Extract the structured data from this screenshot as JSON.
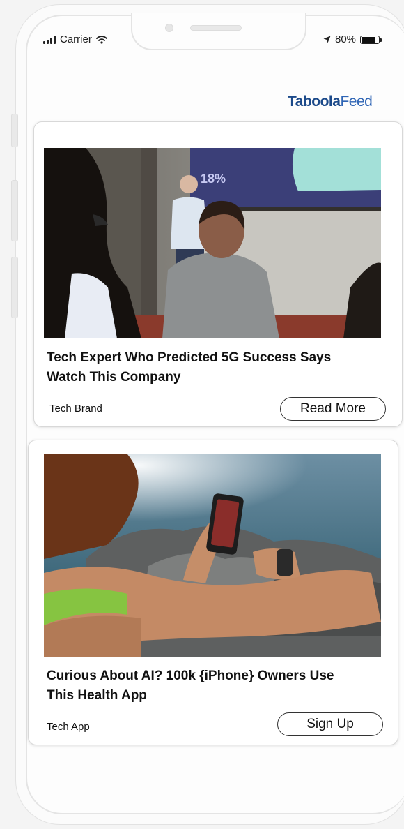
{
  "status": {
    "carrier": "Carrier",
    "battery": "80%"
  },
  "brand": {
    "strong": "Taboola",
    "light": "Feed"
  },
  "cards": [
    {
      "headline": "Tech Expert Who Predicted 5G Success Says Watch This Company",
      "source": "Tech Brand",
      "cta": "Read More",
      "slide_label": "18%"
    },
    {
      "headline": "Curious About AI? 100k {iPhone} Owners Use This Health App",
      "source": "Tech App",
      "cta": "Sign Up"
    }
  ]
}
